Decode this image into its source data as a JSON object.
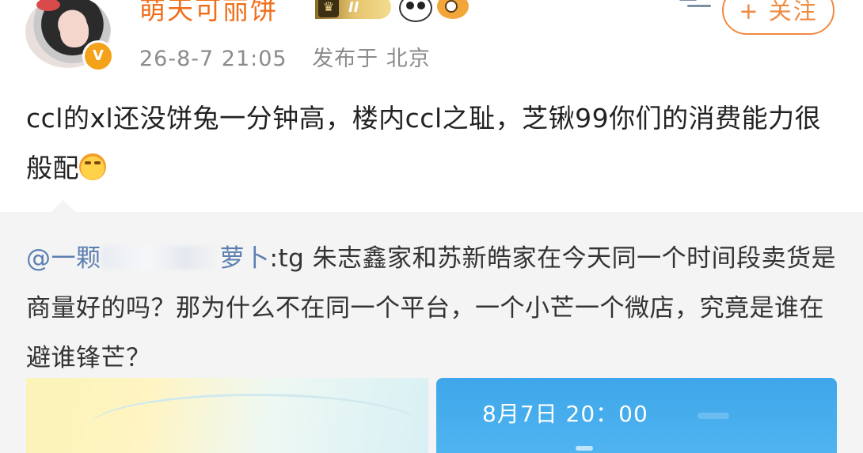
{
  "post": {
    "username": "萌天可丽饼",
    "level_badge": "II",
    "verified_badge": "V",
    "timestamp": "26-8-7 21:05",
    "published_prefix": "发布于",
    "location": "北京",
    "follow_label": "+ 关注",
    "text": "ccl的xl还没饼兔一分钟高，楼内ccl之耻，芝锹99你们的消费能力很般配"
  },
  "repost": {
    "mention_start": "@一颗",
    "mention_end": "萝卜",
    "text": ":tg 朱志鑫家和苏新皓家在今天同一个时间段卖货是商量好的吗？那为什么不在同一个平台，一个小芒一个微店，究竟是谁在避谁锋芒？"
  },
  "images": {
    "right_time": "8月7日 20：00"
  },
  "colors": {
    "username": "#f06e1b",
    "follow": "#f08a40",
    "mention": "#5b7fb0",
    "repost_bg": "#f4f4f4",
    "image_blue": "#3ea6ea"
  },
  "icons": [
    "avatar",
    "verified-v-icon",
    "level-crown-icon",
    "panda-icon",
    "fish-icon",
    "emoji-icon"
  ]
}
